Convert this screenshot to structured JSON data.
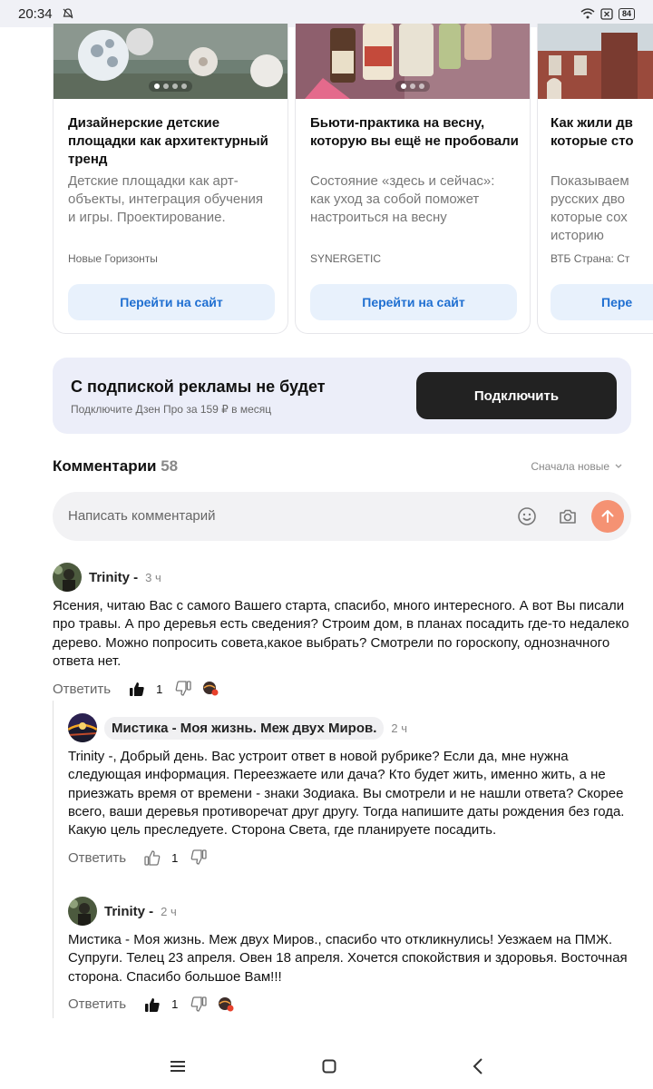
{
  "status": {
    "time": "20:34",
    "battery": "84"
  },
  "cards": [
    {
      "title": "Дизайнерские детские площадки как архитектурный тренд",
      "desc": "Детские площадки как арт-объекты, интеграция обучения и игры. Проектирование.",
      "source": "Новые Горизонты",
      "button": "Перейти на сайт"
    },
    {
      "title": "Бьюти-практика на весну, которую вы ещё не пробовали",
      "desc": "Состояние «здесь и сейчас»: как уход за собой поможет настроиться на весну",
      "source": "SYNERGETIC",
      "button": "Перейти на сайт"
    },
    {
      "title": "Как жили дв которые сто",
      "desc": "Показываем русских дво которые сох историю",
      "source": "ВТБ Страна: Ст",
      "button": "Пере"
    }
  ],
  "promo": {
    "title": "С подпиской рекламы не будет",
    "subtitle": "Подключите Дзен Про за 159 ₽ в месяц",
    "button": "Подключить"
  },
  "comments_header": {
    "label": "Комментарии",
    "count": "58",
    "sort": "Сначала новые"
  },
  "comment_input": {
    "placeholder": "Написать комментарий"
  },
  "comments": [
    {
      "author": "Trinity -",
      "time": "3 ч",
      "text": "Ясения, читаю Вас с самого Вашего старта, спасибо, много интересного. А вот Вы писали про травы. А про деревья есть сведения? Строим дом, в планах посадить где-то недалеко дерево. Можно попросить совета,какое выбрать? Смотрели по гороскопу, однозначного ответа нет.",
      "reply": "Ответить",
      "likes": "1"
    },
    {
      "author": "Мистика - Моя жизнь. Меж двух Миров.",
      "time": "2 ч",
      "text": "Trinity -, Добрый день. Вас устроит ответ в новой рубрике? Если да, мне нужна следующая информация. Переезжаете или дача? Кто будет жить, именно жить, а не приезжать время от времени - знаки Зодиака. Вы смотрели и не нашли ответа? Скорее всего, ваши деревья противоречат друг другу. Тогда напишите даты рождения без года. Какую цель преследуете. Сторона Света, где планируете посадить.",
      "reply": "Ответить",
      "likes": "1"
    },
    {
      "author": "Trinity -",
      "time": "2 ч",
      "text": "Мистика - Моя жизнь. Меж двух Миров., спасибо что откликнулись! Уезжаем на ПМЖ. Супруги. Телец 23 апреля. Овен 18 апреля. Хочется спокойствия и здоровья. Восточная сторона. Спасибо большое Вам!!!",
      "reply": "Ответить",
      "likes": "1"
    }
  ]
}
